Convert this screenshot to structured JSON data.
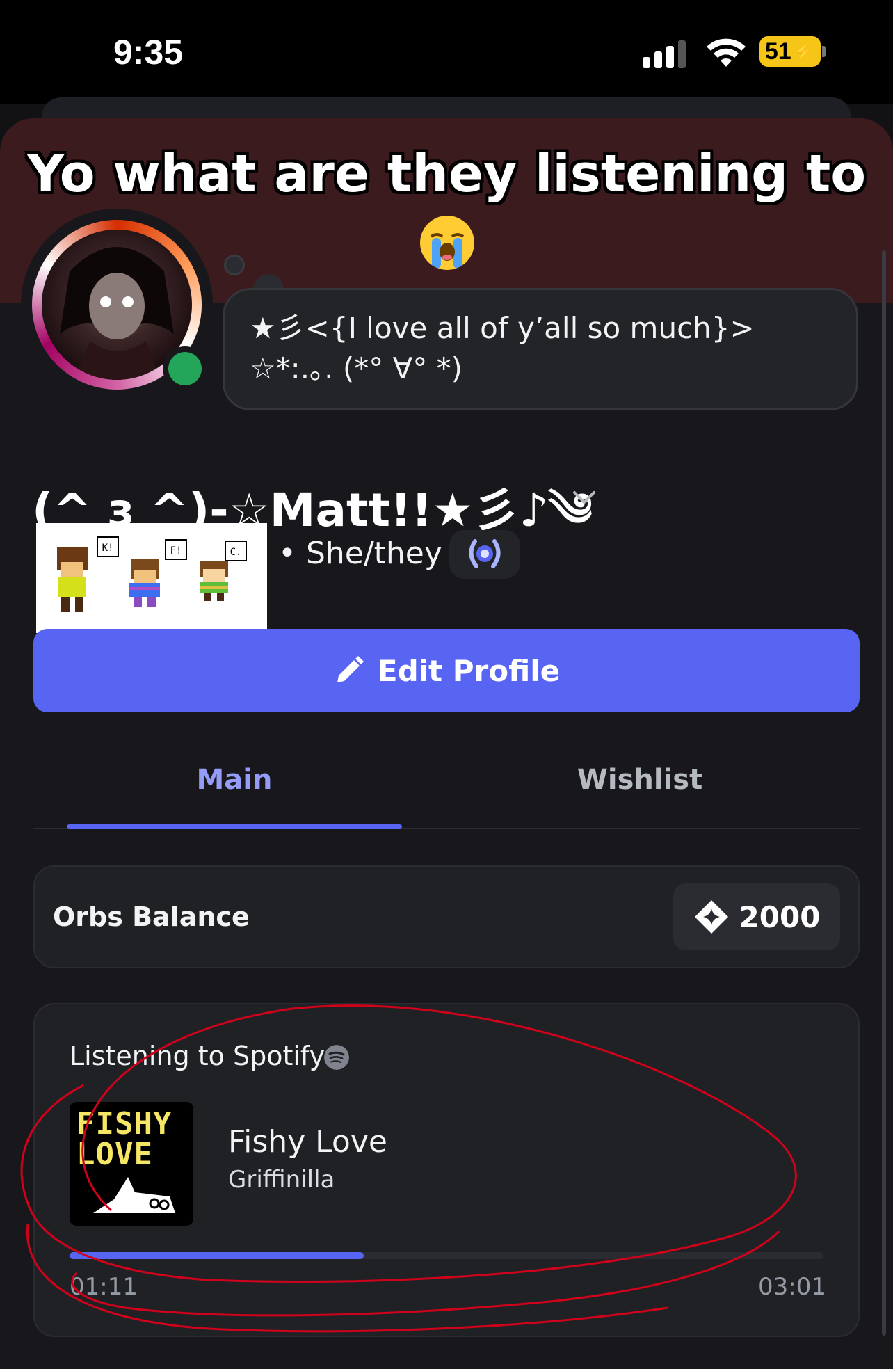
{
  "status_bar": {
    "time": "9:35",
    "battery": "51"
  },
  "overlay_caption": "Yo what are they listening to",
  "profile": {
    "status_message": "★彡<{I love all of y’all so much}> ☆*:.｡. (*° ∀° *)",
    "display_name": "(^ з ^)-☆Matt!!★彡♪༄",
    "pronouns": "• She/they",
    "sprite_labels": [
      "K!",
      "F!",
      "C."
    ]
  },
  "edit_profile_label": "Edit Profile",
  "tabs": [
    {
      "label": "Main",
      "active": true
    },
    {
      "label": "Wishlist",
      "active": false
    }
  ],
  "orbs": {
    "label": "Orbs Balance",
    "value": "2000"
  },
  "spotify": {
    "label": "Listening to Spotify",
    "album_art_text": "FISHY LOVE",
    "track": "Fishy Love",
    "artist": "Griffinilla",
    "elapsed": "01:11",
    "duration": "03:01",
    "progress_fraction": 0.39
  },
  "colors": {
    "accent": "#5865f2",
    "online": "#23a55a",
    "annotation": "#d0021b"
  }
}
